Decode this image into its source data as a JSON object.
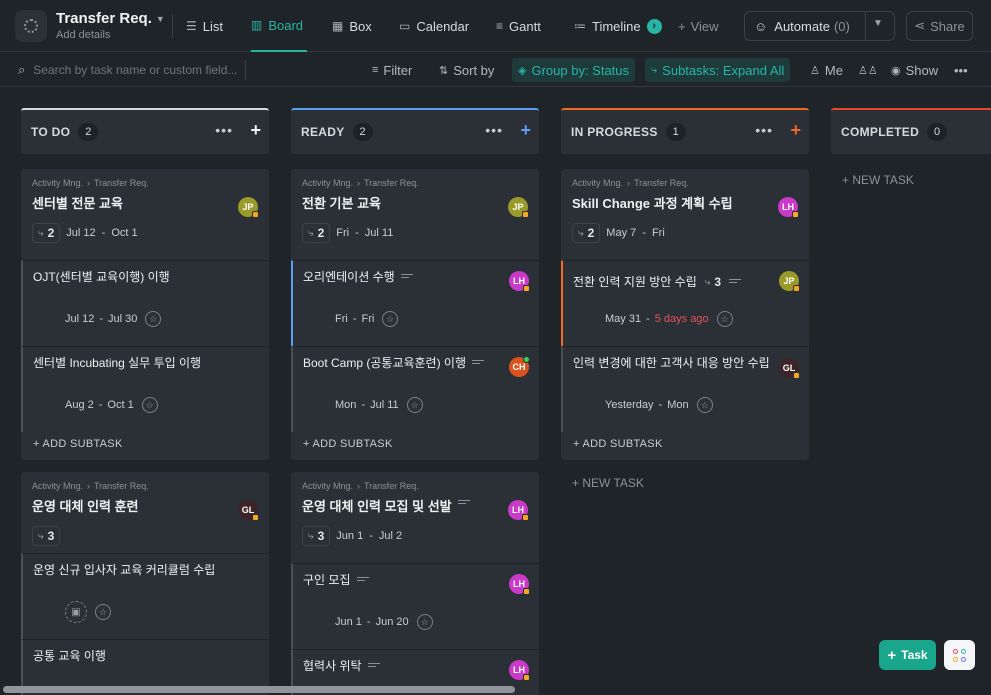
{
  "header": {
    "title": "Transfer Req.",
    "subtitle": "Add details",
    "views": [
      {
        "label": "List",
        "icon": "list-icon"
      },
      {
        "label": "Board",
        "icon": "board-icon",
        "active": true
      },
      {
        "label": "Box",
        "icon": "box-icon"
      },
      {
        "label": "Calendar",
        "icon": "calendar-icon"
      },
      {
        "label": "Gantt",
        "icon": "gantt-icon"
      },
      {
        "label": "Timeline",
        "icon": "timeline-icon"
      }
    ],
    "add_view": "View",
    "automate": "Automate",
    "automate_count": "(0)",
    "share": "Share"
  },
  "toolbar": {
    "search_placeholder": "Search by task name or custom field...",
    "filter": "Filter",
    "sort": "Sort by",
    "group": "Group by: Status",
    "subtasks": "Subtasks: Expand All",
    "me": "Me",
    "show": "Show"
  },
  "colors": {
    "accent": "#27b6a6",
    "todo": "#d7dadd",
    "ready": "#5b9cf5",
    "in_progress": "#f06a2a",
    "completed": "#e8452d"
  },
  "columns": [
    {
      "title": "TO DO",
      "count": "2"
    },
    {
      "title": "READY",
      "count": "2"
    },
    {
      "title": "IN PROGRESS",
      "count": "1"
    },
    {
      "title": "COMPLETED",
      "count": "0"
    }
  ],
  "crumb": {
    "space": "Activity Mng.",
    "list": "Transfer Req."
  },
  "labels": {
    "add_subtask": "+ ADD SUBTASK",
    "new_task": "+ NEW TASK",
    "fab_task": "Task",
    "sep": "-"
  },
  "cards": {
    "c1": {
      "name": "센터별 전문 교육",
      "avatar": "JP",
      "subs": "2",
      "start": "Jul 12",
      "end": "Oct 1",
      "subtasks": [
        {
          "name": "OJT(센터별 교육이행) 이행",
          "start": "Jul 12",
          "end": "Jul 30"
        },
        {
          "name": "센터별 Incubating 실무 투입 이행",
          "start": "Aug 2",
          "end": "Oct 1"
        }
      ]
    },
    "c2": {
      "name": "운영 대체 인력 훈련",
      "avatar": "GL",
      "subs": "3",
      "subtasks": [
        {
          "name": "운영 신규 입사자 교육 커리큘럼 수립"
        },
        {
          "name": "공통 교육 이행"
        }
      ]
    },
    "r1": {
      "name": "전환 기본 교육",
      "avatar": "JP",
      "subs": "2",
      "start": "Fri",
      "end": "Jul 11",
      "subtasks": [
        {
          "name": "오리엔테이션 수행",
          "avatar": "LH",
          "start": "Fri",
          "end": "Fri"
        },
        {
          "name": "Boot Camp (공통교육훈련) 이행",
          "avatar": "CH",
          "start": "Mon",
          "end": "Jul 11"
        }
      ]
    },
    "r2": {
      "name": "운영 대체 인력 모집 및 선발",
      "avatar": "LH",
      "subs": "3",
      "start": "Jun 1",
      "end": "Jul 2",
      "subtasks": [
        {
          "name": "구인 모집",
          "avatar": "LH",
          "start": "Jun 1",
          "end": "Jun 20"
        },
        {
          "name": "협력사 위탁",
          "avatar": "LH"
        }
      ]
    },
    "p1": {
      "name": "Skill Change 과정 계획 수립",
      "avatar": "LH",
      "subs": "2",
      "start": "May 7",
      "end": "Fri",
      "subtasks": [
        {
          "name": "전환 인력 지원 방안 수립",
          "subs": "3",
          "avatar": "JP",
          "start": "May 31",
          "end": "5 days ago"
        },
        {
          "name": "인력 변경에 대한 고객사 대응 방안 수립",
          "avatar": "GL",
          "start": "Yesterday",
          "end": "Mon"
        }
      ]
    }
  }
}
